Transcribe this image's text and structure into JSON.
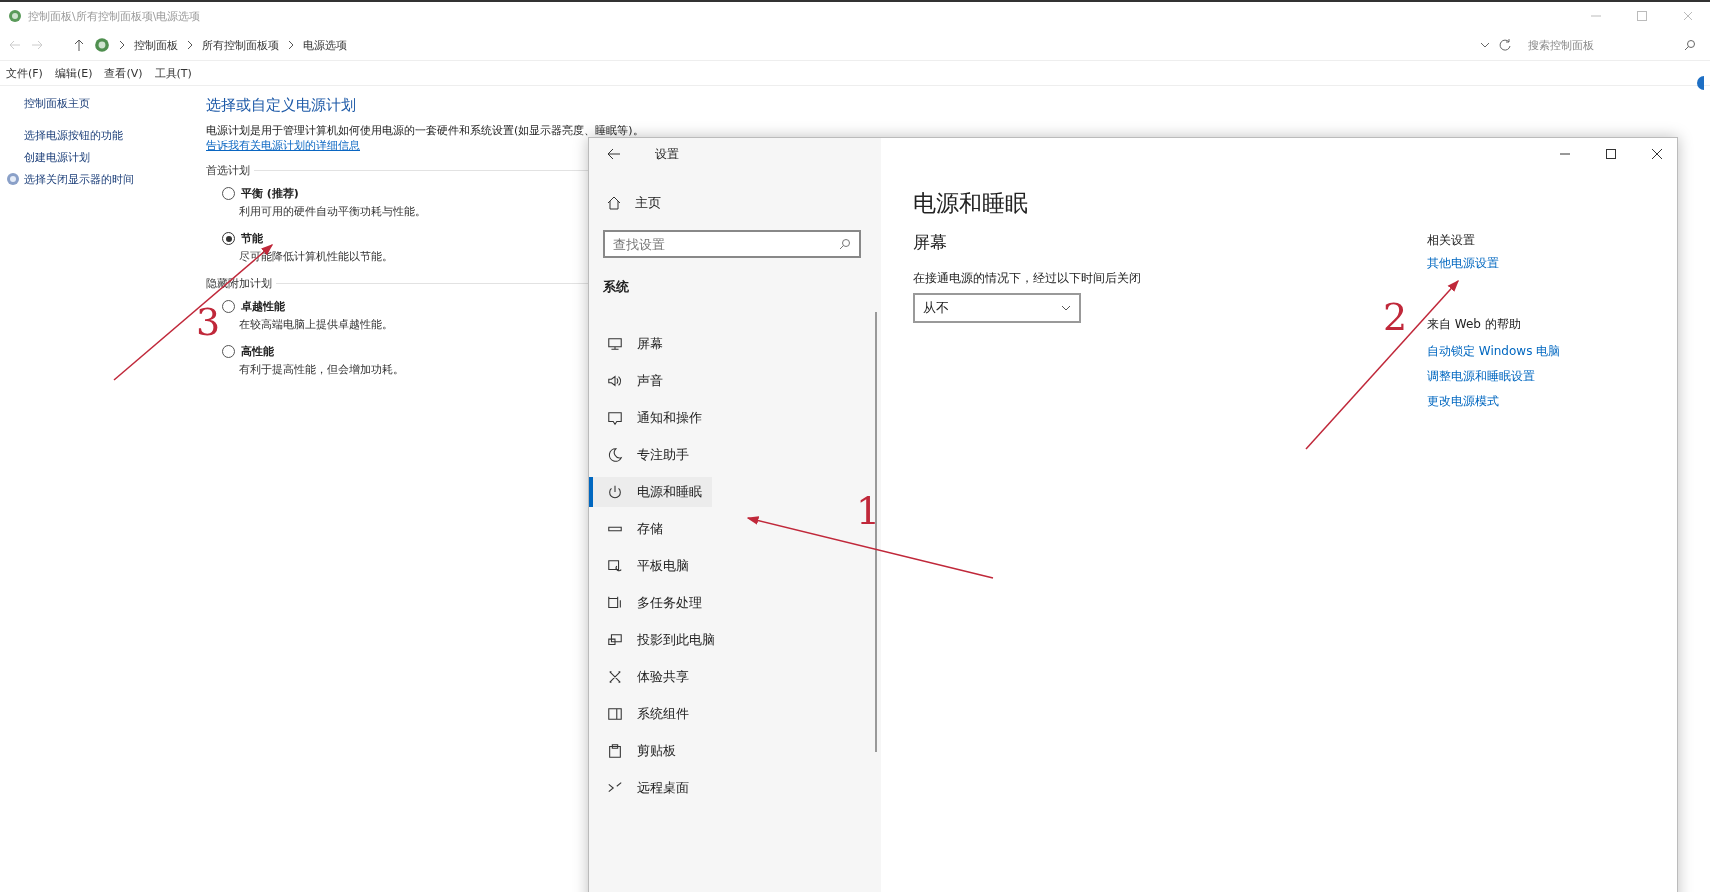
{
  "explorer": {
    "title": "控制面板\\所有控制面板项\\电源选项",
    "breadcrumb": [
      "控制面板",
      "所有控制面板项",
      "电源选项"
    ],
    "search": {
      "placeholder": "搜索控制面板"
    },
    "menu": [
      "文件(F)",
      "编辑(E)",
      "查看(V)",
      "工具(T)"
    ],
    "sidebar": [
      {
        "label": "控制面板主页",
        "kind": "home"
      },
      {
        "label": "选择电源按钮的功能",
        "kind": "link"
      },
      {
        "label": "创建电源计划",
        "kind": "link"
      },
      {
        "label": "选择关闭显示器的时间",
        "kind": "icon-link"
      }
    ],
    "heading": "选择或自定义电源计划",
    "description": "电源计划是用于管理计算机如何使用电源的一套硬件和系统设置(如显示器亮度、睡眠等)。",
    "description_link": "告诉我有关电源计划的详细信息",
    "plan_groups": [
      {
        "title": "首选计划",
        "plans": [
          {
            "name": "平衡 (推荐)",
            "description": "利用可用的硬件自动平衡功耗与性能。",
            "selected": false
          },
          {
            "name": "节能",
            "description": "尽可能降低计算机性能以节能。",
            "selected": true
          }
        ]
      },
      {
        "title": "隐藏附加计划",
        "plans": [
          {
            "name": "卓越性能",
            "description": "在较高端电脑上提供卓越性能。",
            "selected": false
          },
          {
            "name": "高性能",
            "description": "有利于提高性能，但会增加功耗。",
            "selected": false
          }
        ]
      }
    ]
  },
  "settings": {
    "title": "设置",
    "home": "主页",
    "search": {
      "placeholder": "查找设置"
    },
    "section": "系统",
    "nav": [
      {
        "label": "屏幕",
        "selected": false
      },
      {
        "label": "声音",
        "selected": false
      },
      {
        "label": "通知和操作",
        "selected": false
      },
      {
        "label": "专注助手",
        "selected": false
      },
      {
        "label": "电源和睡眠",
        "selected": true
      },
      {
        "label": "存储",
        "selected": false
      },
      {
        "label": "平板电脑",
        "selected": false
      },
      {
        "label": "多任务处理",
        "selected": false
      },
      {
        "label": "投影到此电脑",
        "selected": false
      },
      {
        "label": "体验共享",
        "selected": false
      },
      {
        "label": "系统组件",
        "selected": false
      },
      {
        "label": "剪贴板",
        "selected": false
      },
      {
        "label": "远程桌面",
        "selected": false
      }
    ],
    "page_title": "电源和睡眠",
    "screen_heading": "屏幕",
    "screen_label": "在接通电源的情况下，经过以下时间后关闭",
    "screen_value": "从不",
    "related": {
      "title": "相关设置",
      "links": [
        "其他电源设置"
      ]
    },
    "web_help": {
      "title": "来自 Web 的帮助",
      "links": [
        "自动锁定 Windows 电脑",
        "调整电源和睡眠设置",
        "更改电源模式"
      ]
    }
  },
  "annotations": [
    {
      "number": "1"
    },
    {
      "number": "2"
    },
    {
      "number": "3"
    }
  ]
}
